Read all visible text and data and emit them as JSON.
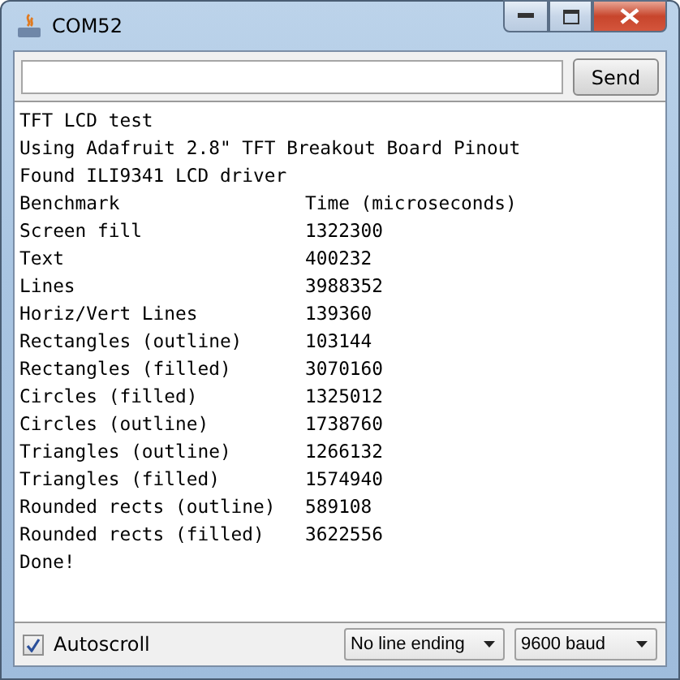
{
  "window": {
    "title": "COM52"
  },
  "send_button": "Send",
  "output": {
    "intro": [
      "TFT LCD test",
      "Using Adafruit 2.8\" TFT Breakout Board Pinout",
      "Found ILI9341 LCD driver"
    ],
    "columns": [
      "Benchmark",
      "Time (microseconds)"
    ],
    "rows": [
      {
        "name": "Screen fill",
        "time": "1322300"
      },
      {
        "name": "Text",
        "time": "400232"
      },
      {
        "name": "Lines",
        "time": "3988352"
      },
      {
        "name": "Horiz/Vert Lines",
        "time": "139360"
      },
      {
        "name": "Rectangles (outline)",
        "time": "103144"
      },
      {
        "name": "Rectangles (filled)",
        "time": "3070160"
      },
      {
        "name": "Circles (filled)",
        "time": "1325012"
      },
      {
        "name": "Circles (outline)",
        "time": "1738760"
      },
      {
        "name": "Triangles (outline)",
        "time": "1266132"
      },
      {
        "name": "Triangles (filled)",
        "time": "1574940"
      },
      {
        "name": "Rounded rects (outline)",
        "time": "589108"
      },
      {
        "name": "Rounded rects (filled)",
        "time": "3622556"
      }
    ],
    "outro": [
      "Done!"
    ]
  },
  "autoscroll": {
    "label": "Autoscroll",
    "checked": true
  },
  "line_ending": "No line ending",
  "baud": "9600 baud"
}
